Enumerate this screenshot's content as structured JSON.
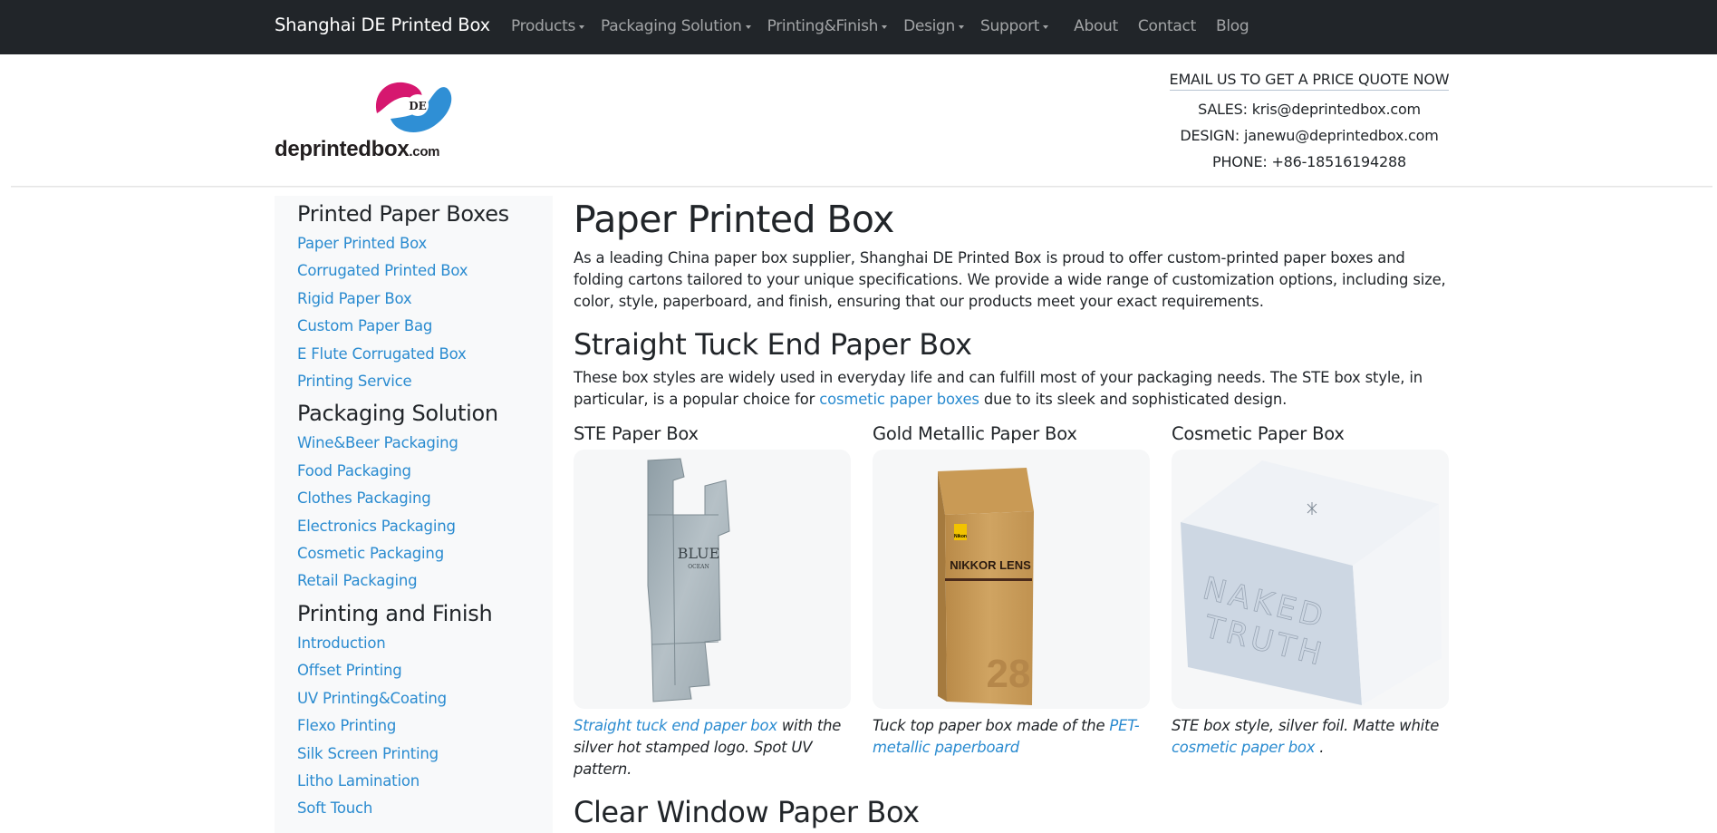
{
  "navbar": {
    "brand": "Shanghai DE Printed Box",
    "items": [
      {
        "label": "Products",
        "dropdown": true
      },
      {
        "label": "Packaging Solution",
        "dropdown": true
      },
      {
        "label": "Printing&Finish",
        "dropdown": true
      },
      {
        "label": "Design",
        "dropdown": true
      },
      {
        "label": "Support",
        "dropdown": true
      },
      {
        "label": "About",
        "dropdown": false
      },
      {
        "label": "Contact",
        "dropdown": false
      },
      {
        "label": "Blog",
        "dropdown": false
      }
    ]
  },
  "header": {
    "logo": {
      "mark_text": "DE",
      "wordmark": "deprintedbox",
      "tld": ".com",
      "colors": {
        "magenta": "#d6176f",
        "blue": "#2f8fd5"
      }
    },
    "contact": {
      "quote_link": "EMAIL US TO GET A PRICE QUOTE NOW",
      "sales": "SALES: kris@deprintedbox.com",
      "design": "DESIGN: janewu@deprintedbox.com",
      "phone": "PHONE: +86-18516194288"
    }
  },
  "sidebar": {
    "groups": [
      {
        "heading": "Printed Paper Boxes",
        "links": [
          "Paper Printed Box",
          "Corrugated Printed Box",
          "Rigid Paper Box",
          "Custom Paper Bag",
          "E Flute Corrugated Box",
          "Printing Service"
        ]
      },
      {
        "heading": "Packaging Solution",
        "links": [
          "Wine&Beer Packaging",
          "Food Packaging",
          "Clothes Packaging",
          "Electronics Packaging",
          "Cosmetic Packaging",
          "Retail Packaging"
        ]
      },
      {
        "heading": "Printing and Finish",
        "links": [
          "Introduction",
          "Offset Printing",
          "UV Printing&Coating",
          "Flexo Printing",
          "Silk Screen Printing",
          "Litho Lamination",
          "Soft Touch"
        ]
      }
    ]
  },
  "main": {
    "title": "Paper Printed Box",
    "intro": "As a leading China paper box supplier, Shanghai DE Printed Box is proud to offer custom-printed paper boxes and folding cartons tailored to your unique specifications. We provide a wide range of customization options, including size, color, style, paperboard, and finish, ensuring that our products meet your exact requirements.",
    "section1": {
      "heading": "Straight Tuck End Paper Box",
      "text_before": "These box styles are widely used in everyday life and can fulfill most of your packaging needs. The STE box style, in particular, is a popular choice for ",
      "link": "cosmetic paper boxes",
      "text_after": " due to its sleek and sophisticated design."
    },
    "cards": [
      {
        "title": "STE Paper Box",
        "image": "blue-ocean-unfolded-box",
        "image_text": [
          "BLUE",
          "OCEAN"
        ],
        "caption_link": "Straight tuck end paper box",
        "caption_text": " with the silver hot stamped logo. Spot UV pattern.",
        "caption_link2": "",
        "caption_end": ""
      },
      {
        "title": "Gold Metallic Paper Box",
        "image": "nikkor-lens-box",
        "image_text": [
          "NIKKOR LENS",
          "28",
          "Nikon"
        ],
        "caption_prefix": "Tuck top paper box made of the ",
        "caption_link": "PET-metallic paperboard"
      },
      {
        "title": "Cosmetic Paper Box",
        "image": "naked-truth-box",
        "image_text": [
          "NAKED",
          "TRUTH"
        ],
        "caption_prefix": "STE box style, silver foil. Matte white ",
        "caption_link": "cosmetic paper box",
        "caption_end": " ."
      }
    ],
    "section2": {
      "heading": "Clear Window Paper Box"
    }
  }
}
